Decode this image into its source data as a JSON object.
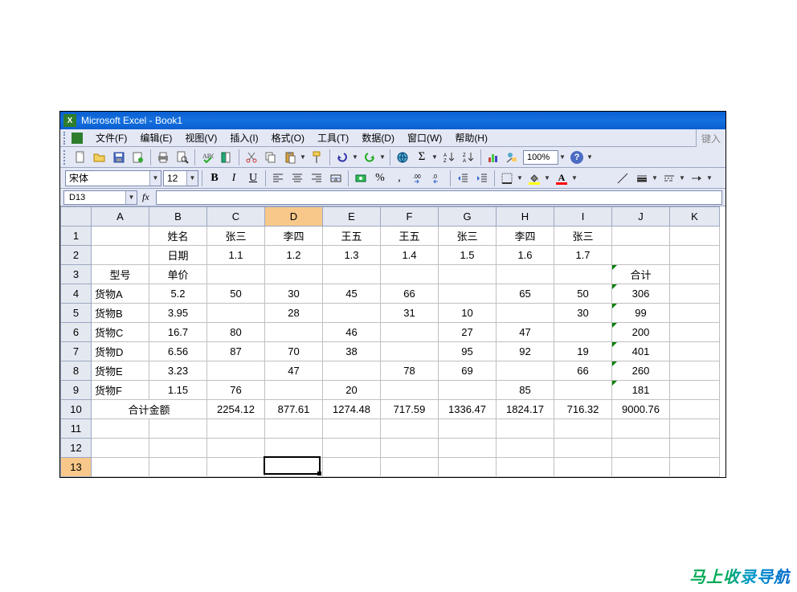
{
  "window": {
    "title": "Microsoft Excel - Book1"
  },
  "menu": {
    "file": "文件(F)",
    "edit": "编辑(E)",
    "view": "视图(V)",
    "insert": "插入(I)",
    "format": "格式(O)",
    "tools": "工具(T)",
    "data": "数据(D)",
    "window": "窗口(W)",
    "help": "帮助(H)"
  },
  "help_prompt": "键入",
  "toolbar": {
    "zoom": "100%"
  },
  "formatbar": {
    "font": "宋体",
    "size": "12"
  },
  "formula": {
    "namebox": "D13",
    "fx": "fx"
  },
  "columns": [
    "A",
    "B",
    "C",
    "D",
    "E",
    "F",
    "G",
    "H",
    "I",
    "J",
    "K"
  ],
  "rows": [
    "1",
    "2",
    "3",
    "4",
    "5",
    "6",
    "7",
    "8",
    "9",
    "10",
    "11",
    "12",
    "13"
  ],
  "cells": {
    "B1": "姓名",
    "C1": "张三",
    "D1": "李四",
    "E1": "王五",
    "F1": "王五",
    "G1": "张三",
    "H1": "李四",
    "I1": "张三",
    "B2": "日期",
    "C2": "1.1",
    "D2": "1.2",
    "E2": "1.3",
    "F2": "1.4",
    "G2": "1.5",
    "H2": "1.6",
    "I2": "1.7",
    "A3": "型号",
    "B3": "单价",
    "J3": "合计",
    "A4": "货物A",
    "B4": "5.2",
    "C4": "50",
    "D4": "30",
    "E4": "45",
    "F4": "66",
    "H4": "65",
    "I4": "50",
    "J4": "306",
    "A5": "货物B",
    "B5": "3.95",
    "D5": "28",
    "F5": "31",
    "G5": "10",
    "I5": "30",
    "J5": "99",
    "A6": "货物C",
    "B6": "16.7",
    "C6": "80",
    "E6": "46",
    "G6": "27",
    "H6": "47",
    "J6": "200",
    "A7": "货物D",
    "B7": "6.56",
    "C7": "87",
    "D7": "70",
    "E7": "38",
    "G7": "95",
    "H7": "92",
    "I7": "19",
    "J7": "401",
    "A8": "货物E",
    "B8": "3.23",
    "D8": "47",
    "F8": "78",
    "G8": "69",
    "I8": "66",
    "J8": "260",
    "A9": "货物F",
    "B9": "1.15",
    "C9": "76",
    "E9": "20",
    "H9": "85",
    "J9": "181",
    "A10": "合计金额",
    "C10": "2254.12",
    "D10": "877.61",
    "E10": "1274.48",
    "F10": "717.59",
    "G10": "1336.47",
    "H10": "1824.17",
    "I10": "716.32",
    "J10": "9000.76"
  },
  "active_cell": "D13",
  "selected_col": "D",
  "watermark": "马上收录导航"
}
